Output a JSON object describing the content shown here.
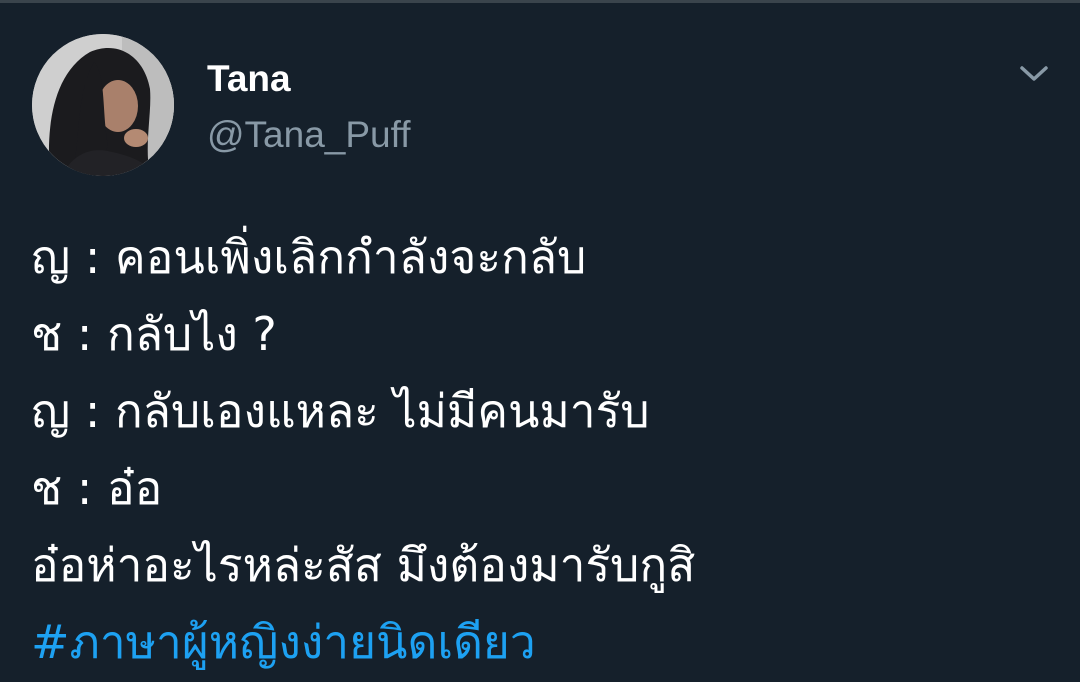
{
  "tweet": {
    "author": {
      "display_name": "Tana",
      "handle": "@Tana_Puff",
      "avatar_icon": "profile-photo"
    },
    "menu_icon": "chevron-down-icon",
    "lines": [
      "ญ : คอนเพิ่งเลิกกำลังจะกลับ",
      "ช : กลับไง ?",
      "ญ : กลับเองแหละ ไม่มีคนมารับ",
      "ช : อ๋อ",
      "อ๋อห่าอะไรหล่ะสัส มึงต้องมารับกูสิ"
    ],
    "hashtag": "#ภาษาผู้หญิงง่ายนิดเดียว"
  },
  "colors": {
    "background": "#15202b",
    "text_primary": "#ffffff",
    "text_secondary": "#8899a6",
    "link": "#1da1f2"
  }
}
